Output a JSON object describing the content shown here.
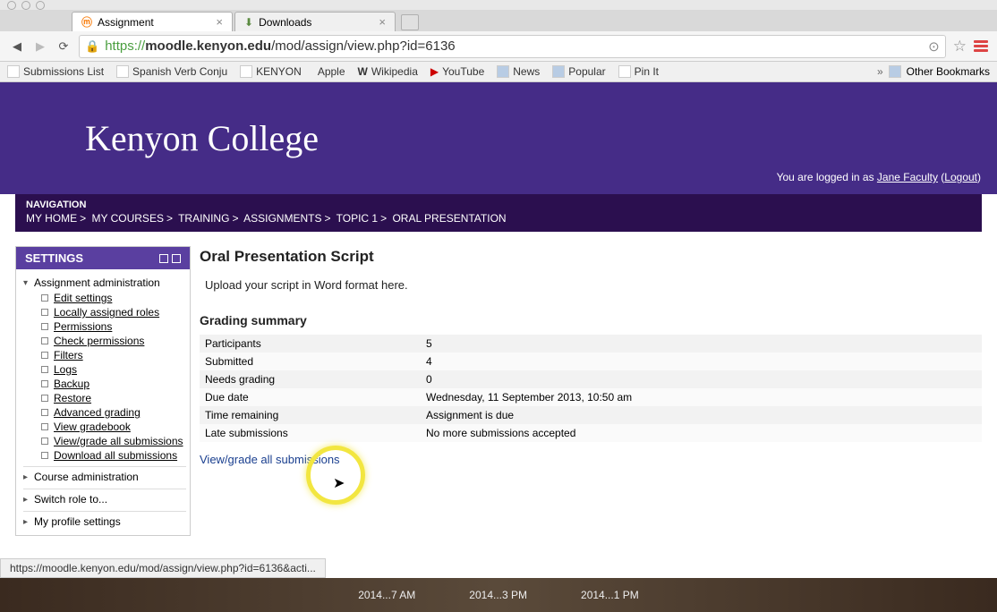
{
  "browser": {
    "tabs": [
      {
        "title": "Assignment",
        "active": true
      },
      {
        "title": "Downloads",
        "active": false
      }
    ],
    "url_proto": "https://",
    "url_host": "moodle.kenyon.edu",
    "url_path": "/mod/assign/view.php?id=6136",
    "bookmarks": [
      "Submissions List",
      "Spanish Verb Conju",
      "KENYON",
      "Apple",
      "Wikipedia",
      "YouTube",
      "News",
      "Popular",
      "Pin It"
    ],
    "other_bookmarks": "Other Bookmarks"
  },
  "header": {
    "logo": "Kenyon College",
    "login_prefix": "You are logged in as ",
    "user": "Jane Faculty",
    "logout": "Logout"
  },
  "nav": {
    "title": "NAVIGATION",
    "crumbs": [
      "MY HOME",
      "MY COURSES",
      "TRAINING",
      "ASSIGNMENTS",
      "TOPIC 1",
      "ORAL PRESENTATION"
    ]
  },
  "settings_block": {
    "title": "SETTINGS",
    "root": "Assignment administration",
    "items": [
      "Edit settings",
      "Locally assigned roles",
      "Permissions",
      "Check permissions",
      "Filters",
      "Logs",
      "Backup",
      "Restore",
      "Advanced grading",
      "View gradebook",
      "View/grade all submissions",
      "Download all submissions"
    ],
    "others": [
      "Course administration",
      "Switch role to...",
      "My profile settings"
    ]
  },
  "main": {
    "title": "Oral Presentation Script",
    "desc": "Upload your script in Word format here.",
    "section": "Grading summary",
    "rows": [
      {
        "label": "Participants",
        "value": "5"
      },
      {
        "label": "Submitted",
        "value": "4"
      },
      {
        "label": "Needs grading",
        "value": "0"
      },
      {
        "label": "Due date",
        "value": "Wednesday, 11 September 2013, 10:50 am"
      },
      {
        "label": "Time remaining",
        "value": "Assignment is due"
      },
      {
        "label": "Late submissions",
        "value": "No more submissions accepted"
      }
    ],
    "view_link": "View/grade all submissions"
  },
  "status_bar": "https://moodle.kenyon.edu/mod/assign/view.php?id=6136&acti...",
  "bottom": [
    "2014...7 AM",
    "2014...3 PM",
    "2014...1 PM"
  ]
}
